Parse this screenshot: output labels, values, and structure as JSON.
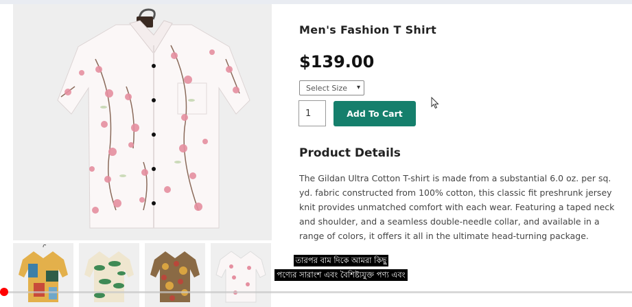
{
  "product": {
    "title": "Men's Fashion T Shirt",
    "price": "$139.00",
    "size_placeholder": "Select Size",
    "quantity": "1",
    "add_to_cart_label": "Add To Cart",
    "details_heading": "Product Details",
    "description": "The Gildan Ultra Cotton T-shirt is made from a substantial 6.0 oz. per sq. yd. fabric constructed from 100% cotton, this classic fit preshrunk jersey knit provides unmatched comfort with each wear. Featuring a taped neck and shoulder, and a seamless double-needle collar, and available in a range of colors, it offers it all in the ultimate head-turning package."
  },
  "gallery": {
    "main_image": "floral-white-shirt",
    "thumbnails": [
      "multicolor-print-shirt",
      "green-leaf-shirt",
      "brown-floral-shirt",
      "pink-floral-shirt"
    ]
  },
  "video": {
    "captions": [
      "তারপর বাম দিকে আমরা কিছু",
      "পণ্যের সারাংশ এবং বৈশিষ্ট্যযুক্ত পণ্য এবং"
    ],
    "progress_fraction": 0.005
  },
  "colors": {
    "accent": "#157f6c",
    "progress": "#ff0000"
  }
}
